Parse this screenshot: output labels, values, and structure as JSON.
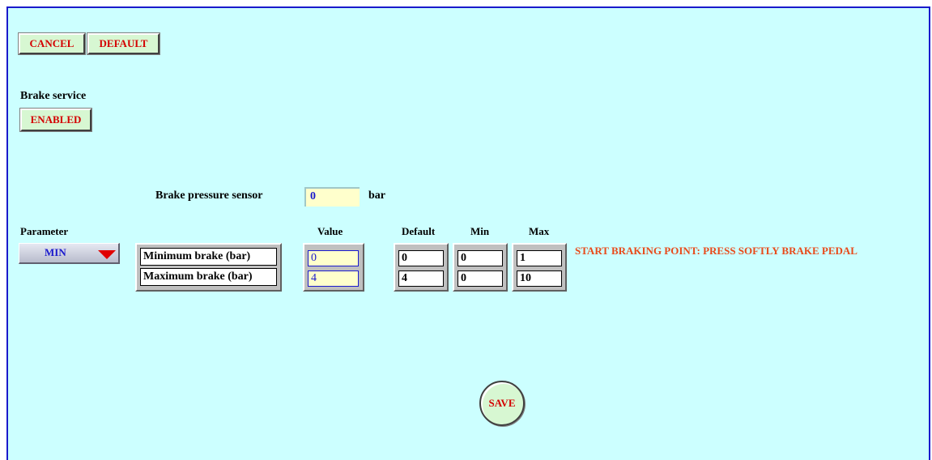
{
  "toolbar": {
    "cancel_label": "CANCEL",
    "default_label": "DEFAULT"
  },
  "brake_service": {
    "label": "Brake service",
    "status": "ENABLED"
  },
  "sensor": {
    "label": "Brake pressure sensor",
    "value": "0",
    "unit": "bar"
  },
  "parameter": {
    "label": "Parameter",
    "selected": "MIN"
  },
  "table": {
    "headers": {
      "value": "Value",
      "default": "Default",
      "min": "Min",
      "max": "Max"
    },
    "rows": [
      {
        "name": "Minimum brake (bar)",
        "value": "0",
        "default": "0",
        "min": "0",
        "max": "1"
      },
      {
        "name": "Maximum brake (bar)",
        "value": "4",
        "default": "4",
        "min": "0",
        "max": "10"
      }
    ]
  },
  "message": "START BRAKING POINT: PRESS SOFTLY BRAKE PEDAL",
  "save_label": "SAVE",
  "colors": {
    "background": "#ccffff",
    "border": "#1a1acc",
    "button_face": "#d7f7d2",
    "button_text": "#d40000",
    "message": "#e84a1a",
    "input_yellow": "#ffffcc"
  }
}
